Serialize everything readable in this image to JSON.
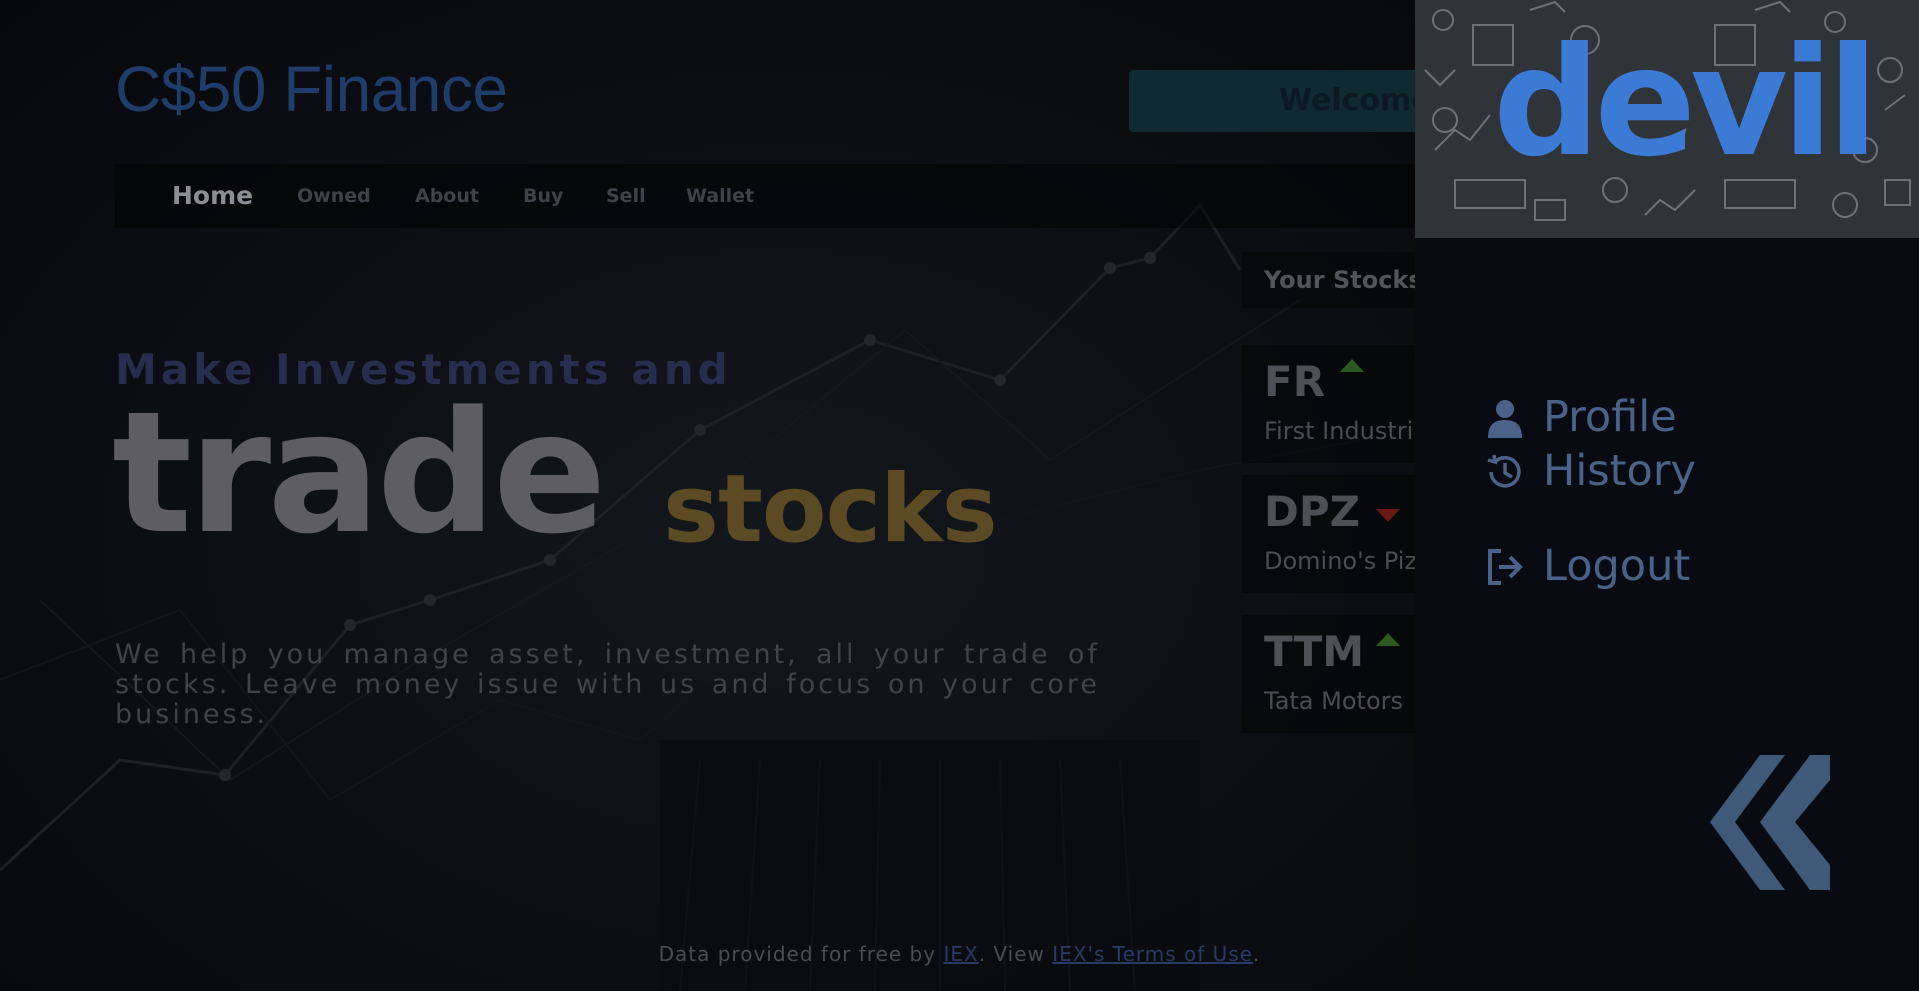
{
  "header": {
    "brand": "C$50 Finance",
    "welcome_text": "Welcome"
  },
  "nav": {
    "items": [
      "Home",
      "Owned",
      "About",
      "Buy",
      "Sell",
      "Wallet"
    ]
  },
  "hero": {
    "tagline": "Make Investments and",
    "big_word": "trade",
    "accent_word": "stocks",
    "description": "We help you manage asset, investment, all your trade of stocks. Leave money issue with us and focus on your core business."
  },
  "stocks": {
    "title": "Your Stocks",
    "items": [
      {
        "symbol": "FR",
        "name": "First Industrial",
        "trend": "up"
      },
      {
        "symbol": "DPZ",
        "name": "Domino's Pizza",
        "trend": "down"
      },
      {
        "symbol": "TTM",
        "name": "Tata Motors",
        "trend": "up"
      }
    ]
  },
  "footer": {
    "prefix": "Data provided for free by ",
    "link1": "IEX",
    "middle": ". View ",
    "link2": "IEX's Terms of Use",
    "suffix": "."
  },
  "sidebar": {
    "username": "devil",
    "menu": [
      {
        "label": "Profile",
        "icon": "user-icon"
      },
      {
        "label": "History",
        "icon": "history-icon"
      },
      {
        "label": "Logout",
        "icon": "logout-icon"
      }
    ],
    "logo_icon": "brand-chevron-logo"
  },
  "colors": {
    "brand": "#1f3d6a",
    "username": "#3b7bd6",
    "trend_up": "#2a5a1e",
    "trend_down": "#6a1a15",
    "accent_gold": "#5c4a25"
  }
}
